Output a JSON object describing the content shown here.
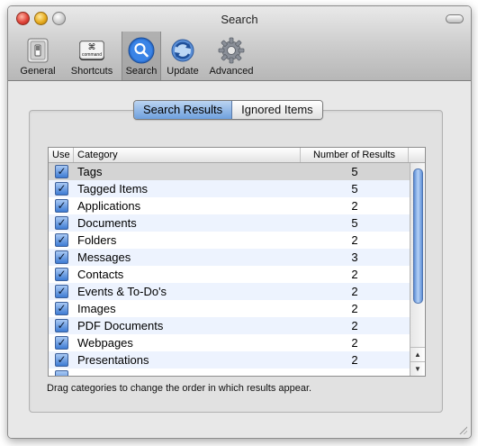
{
  "window": {
    "title": "Search"
  },
  "toolbar": {
    "items": [
      {
        "label": "General",
        "icon": "general-switch-icon"
      },
      {
        "label": "Shortcuts",
        "icon": "command-key-icon",
        "key_text": "⌘",
        "key_sub": "command"
      },
      {
        "label": "Search",
        "icon": "magnifier-icon",
        "selected": true
      },
      {
        "label": "Update",
        "icon": "refresh-globe-icon"
      },
      {
        "label": "Advanced",
        "icon": "gear-icon"
      }
    ]
  },
  "segments": [
    {
      "label": "Search Results",
      "active": true
    },
    {
      "label": "Ignored Items",
      "active": false
    }
  ],
  "table": {
    "headers": {
      "use": "Use",
      "category": "Category",
      "count": "Number of Results"
    },
    "rows": [
      {
        "checked": true,
        "category": "Tags",
        "count": "5",
        "selected": true
      },
      {
        "checked": true,
        "category": "Tagged Items",
        "count": "5"
      },
      {
        "checked": true,
        "category": "Applications",
        "count": "2"
      },
      {
        "checked": true,
        "category": "Documents",
        "count": "5"
      },
      {
        "checked": true,
        "category": "Folders",
        "count": "2"
      },
      {
        "checked": true,
        "category": "Messages",
        "count": "3"
      },
      {
        "checked": true,
        "category": "Contacts",
        "count": "2"
      },
      {
        "checked": true,
        "category": "Events & To-Do's",
        "count": "2"
      },
      {
        "checked": true,
        "category": "Images",
        "count": "2"
      },
      {
        "checked": true,
        "category": "PDF Documents",
        "count": "2"
      },
      {
        "checked": true,
        "category": "Webpages",
        "count": "2"
      },
      {
        "checked": true,
        "category": "Presentations",
        "count": "2"
      }
    ],
    "checkmark": "✓"
  },
  "hint": "Drag categories to change the order in which results appear.",
  "colors": {
    "accent": "#3d7bd3",
    "selected_row": "#d4d4d4",
    "alt_row": "#edf3fe"
  }
}
